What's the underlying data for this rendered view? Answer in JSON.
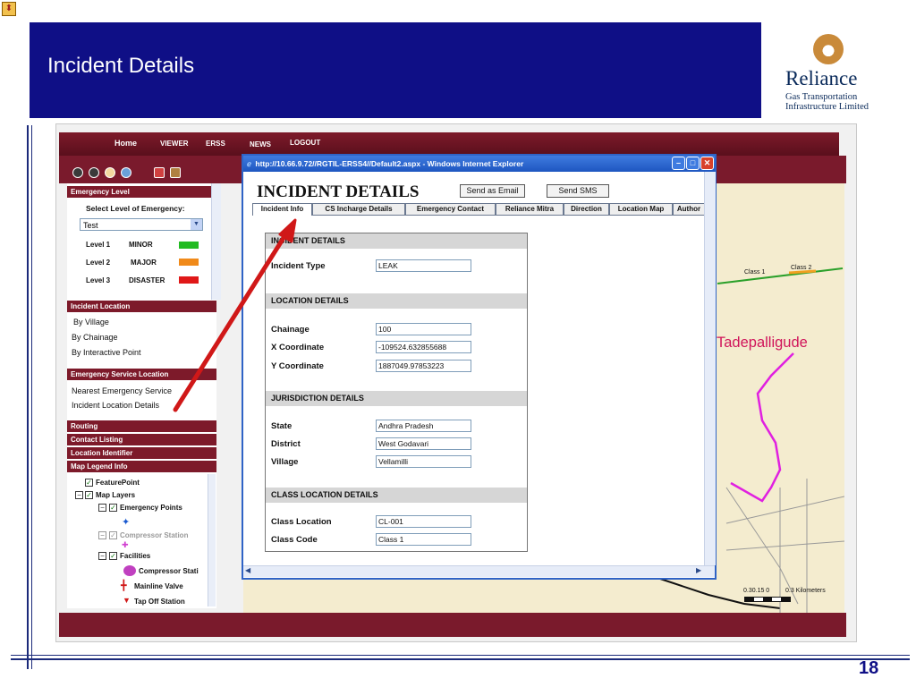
{
  "slide": {
    "title": "Incident Details",
    "page_number": "18",
    "logo": {
      "name": "Reliance",
      "subtitle_line1": "Gas Transportation",
      "subtitle_line2": "Infrastructure Limited"
    },
    "colors": {
      "title_band": "#0f0f86",
      "app_maroon": "#7a1a2c",
      "arrow": "#d01818"
    }
  },
  "app": {
    "nav": [
      "Home",
      "VIEWER",
      "ERSS",
      "NEWS",
      "LOGOUT"
    ],
    "left_panel": {
      "emergency_level": {
        "header": "Emergency Level",
        "prompt": "Select Level of Emergency:",
        "selected": "Test",
        "levels": [
          {
            "level": "Level 1",
            "name": "MINOR",
            "color": "#22bb22"
          },
          {
            "level": "Level 2",
            "name": "MAJOR",
            "color": "#f08a1a"
          },
          {
            "level": "Level 3",
            "name": "DISASTER",
            "color": "#e01818"
          }
        ]
      },
      "incident_location": {
        "header": "Incident Location",
        "items": [
          "By Village",
          "By Chainage",
          "By Interactive Point"
        ]
      },
      "emergency_service_location": {
        "header": "Emergency Service Location",
        "items": [
          "Nearest Emergency Service",
          "Incident Location Details"
        ]
      },
      "collapsed_headers": [
        "Routing",
        "Contact Listing",
        "Location Identifier",
        "Map Legend Info"
      ],
      "legend": {
        "feature_point": "FeaturePoint",
        "map_layers": "Map Layers",
        "emergency_points": "Emergency Points",
        "compressor_station": "Compressor Station",
        "facilities": "Facilities",
        "facility_items": [
          "Compressor Stati",
          "Mainline Valve",
          "Tap Off Station"
        ]
      }
    },
    "popup": {
      "title_bar": "http://10.66.9.72//RGTIL-ERSS4//Default2.aspx - Windows Internet Explorer",
      "heading": "INCIDENT DETAILS",
      "send_email": "Send as Email",
      "send_sms": "Send SMS",
      "tabs": [
        "Incident Info",
        "CS Incharge Details",
        "Emergency Contact",
        "Reliance Mitra",
        "Direction",
        "Location Map",
        "Author"
      ],
      "sections": {
        "incident": {
          "title": "INCIDENT DETAILS",
          "incident_type_label": "Incident Type",
          "incident_type": "LEAK"
        },
        "location": {
          "title": "LOCATION DETAILS",
          "chainage_label": "Chainage",
          "chainage": "100",
          "x_label": "X Coordinate",
          "x": "-109524.632855688",
          "y_label": "Y Coordinate",
          "y": "1887049.97853223"
        },
        "jurisdiction": {
          "title": "JURISDICTION DETAILS",
          "state_label": "State",
          "state": "Andhra Pradesh",
          "district_label": "District",
          "district": "West Godavari",
          "village_label": "Village",
          "village": "Vellamilli"
        },
        "class_location": {
          "title": "CLASS LOCATION DETAILS",
          "class_location_label": "Class Location",
          "class_location": "CL-001",
          "class_code_label": "Class Code",
          "class_code": "Class 1"
        }
      }
    },
    "map": {
      "place": "Tadepalligude",
      "class1": "Class 1",
      "class2": "Class 2",
      "scale": "0.30.15 0",
      "scale_unit": "0.3 Kilometers"
    }
  }
}
